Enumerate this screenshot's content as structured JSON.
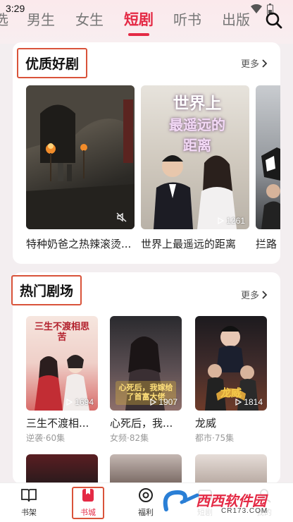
{
  "status": {
    "time": "3:29"
  },
  "tabs": [
    {
      "label": "选"
    },
    {
      "label": "男生"
    },
    {
      "label": "女生"
    },
    {
      "label": "短剧"
    },
    {
      "label": "听书"
    },
    {
      "label": "出版"
    }
  ],
  "section1": {
    "title": "优质好剧",
    "more": "更多",
    "items": [
      {
        "title": "特种奶爸之热辣滚烫...",
        "views": ""
      },
      {
        "title": "世界上最遥远的距离",
        "views": "1261",
        "poster_text_line1": "世界上",
        "poster_text_line2": "最遥远的",
        "poster_text_line3": "距离"
      },
      {
        "title": "拦路"
      }
    ]
  },
  "section2": {
    "title": "热门剧场",
    "more": "更多",
    "items": [
      {
        "title": "三生不渡相...",
        "genre": "逆袭·60集",
        "views": "1694",
        "poster_text": "三生不渡相思苦"
      },
      {
        "title": "心死后，我...",
        "genre": "女频·82集",
        "views": "1907",
        "poster_text": "心死后，我嫁给了首富大佬"
      },
      {
        "title": "龙威",
        "genre": "都市·75集",
        "views": "1814",
        "poster_text": "龙威"
      }
    ]
  },
  "bottom_nav": [
    {
      "label": "书架"
    },
    {
      "label": "书城"
    },
    {
      "label": "福利"
    },
    {
      "label": "短剧"
    },
    {
      "label": "我的"
    }
  ],
  "watermark": {
    "brand": "西西软件园",
    "url": "CR173.COM"
  },
  "colors": {
    "accent": "#e42a45",
    "highlight_box": "#d9533a",
    "background": "#f3eef0"
  }
}
